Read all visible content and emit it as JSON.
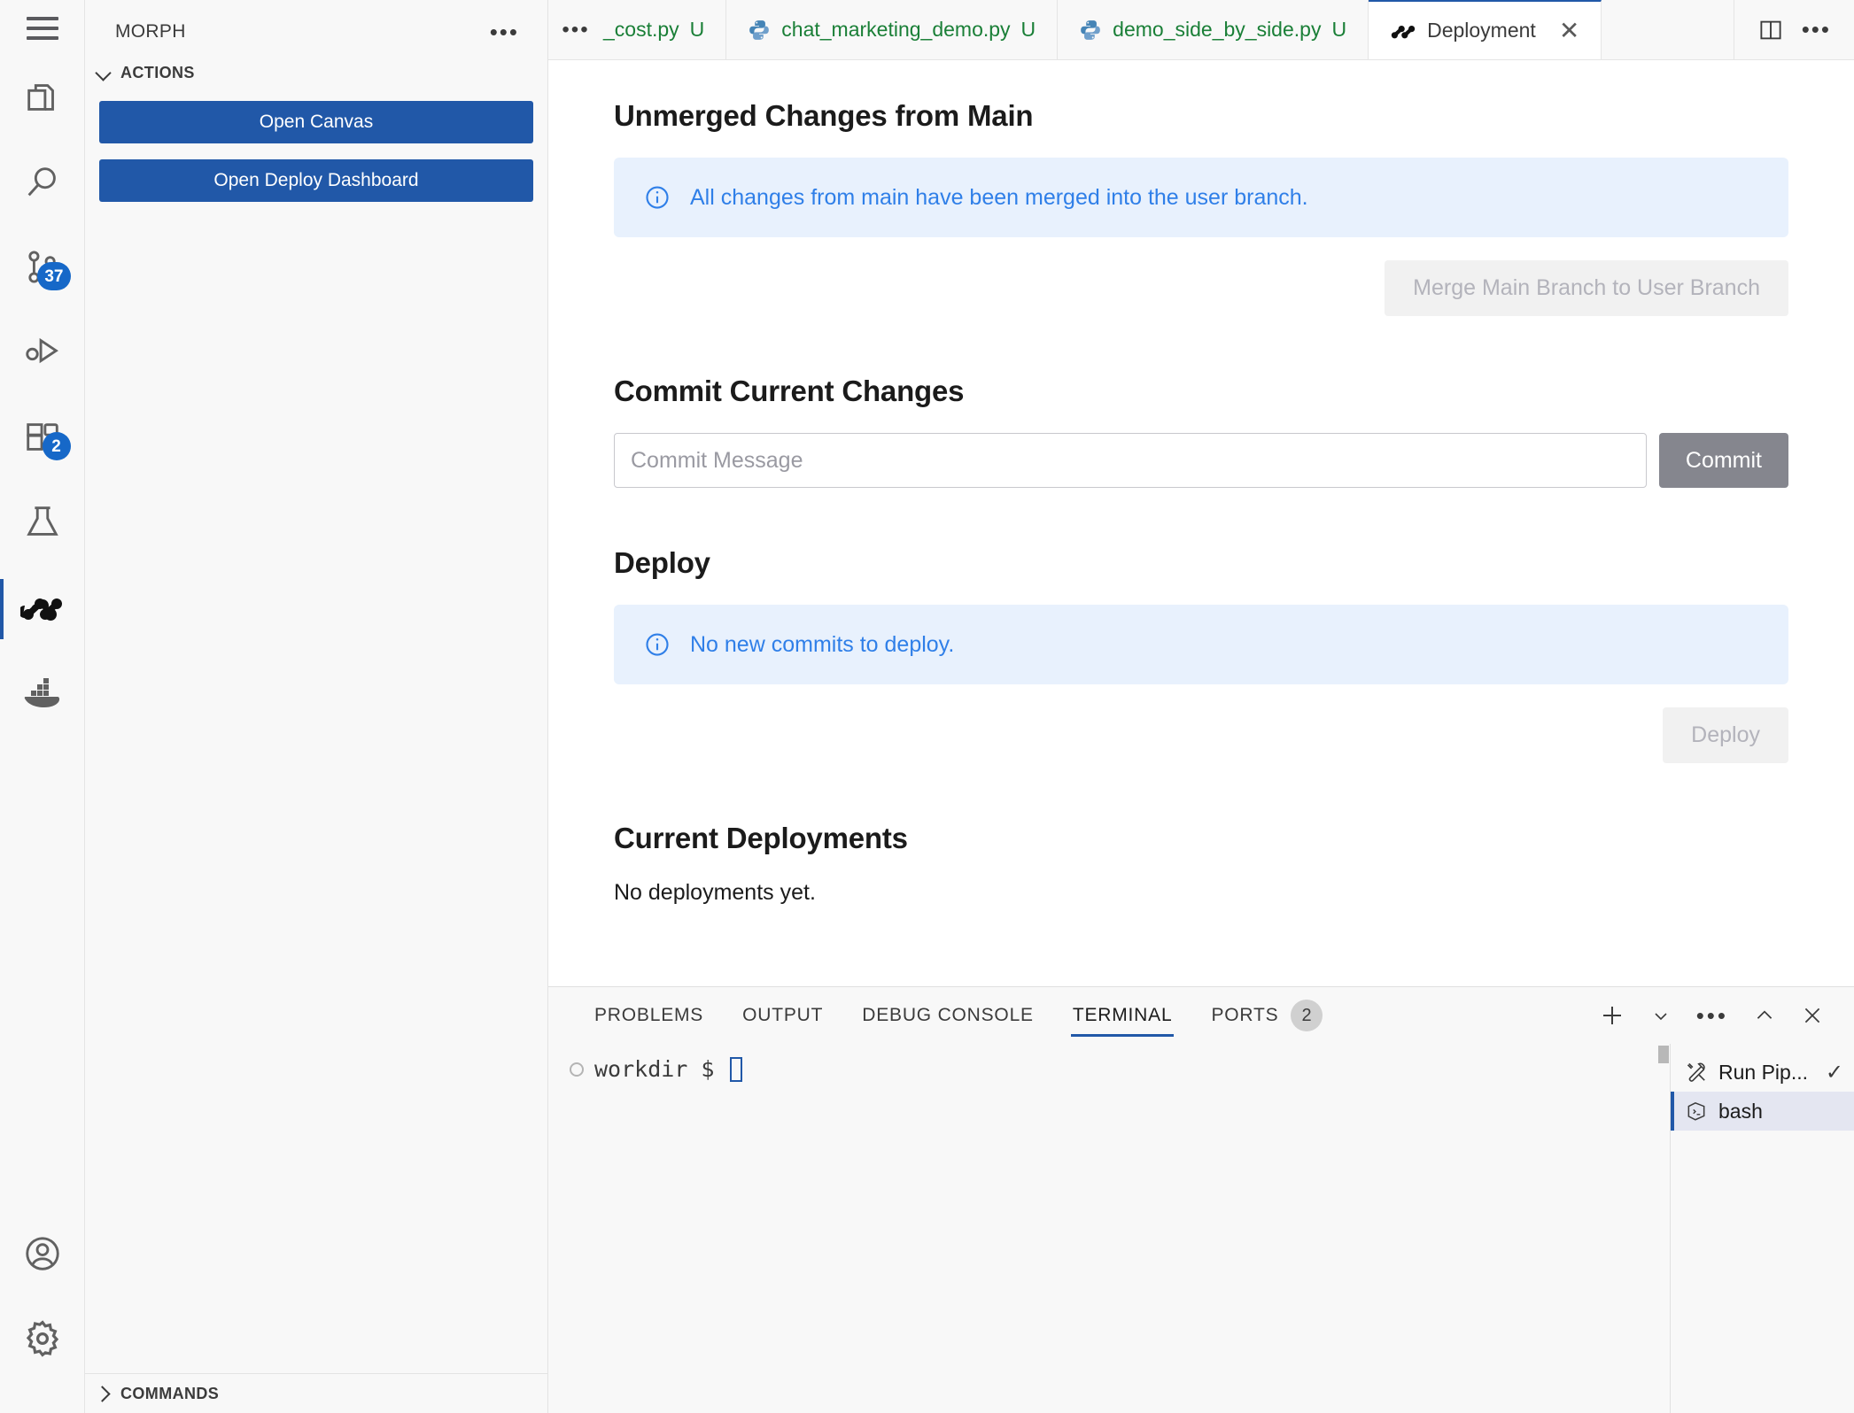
{
  "activity_bar": {
    "menu_icon": "hamburger-menu-icon",
    "items": [
      {
        "name": "explorer",
        "icon": "files-icon",
        "badge": null,
        "active": false
      },
      {
        "name": "search",
        "icon": "search-icon",
        "badge": null,
        "active": false
      },
      {
        "name": "source-control",
        "icon": "source-control-icon",
        "badge": "37",
        "active": false
      },
      {
        "name": "run-and-debug",
        "icon": "run-debug-icon",
        "badge": null,
        "active": false
      },
      {
        "name": "extensions",
        "icon": "extensions-icon",
        "badge": "2",
        "active": false
      },
      {
        "name": "testing",
        "icon": "beaker-icon",
        "badge": null,
        "active": false
      },
      {
        "name": "morph",
        "icon": "morph-icon",
        "badge": null,
        "active": true
      },
      {
        "name": "docker",
        "icon": "docker-whale-icon",
        "badge": null,
        "active": false
      }
    ],
    "bottom_items": [
      {
        "name": "accounts",
        "icon": "account-icon"
      },
      {
        "name": "settings",
        "icon": "gear-icon"
      }
    ]
  },
  "sidebar": {
    "title": "MORPH",
    "more_label": "•••",
    "sections": [
      {
        "label": "ACTIONS",
        "expanded": true
      },
      {
        "label": "COMMANDS",
        "expanded": false
      }
    ],
    "buttons": [
      {
        "label": "Open Canvas"
      },
      {
        "label": "Open Deploy Dashboard"
      }
    ]
  },
  "tabs": {
    "overflow_label": "•••",
    "items": [
      {
        "label": "_cost.py",
        "dirty": "U",
        "icon": "python-icon",
        "active": false,
        "truncated": true
      },
      {
        "label": "chat_marketing_demo.py",
        "dirty": "U",
        "icon": "python-icon",
        "active": false,
        "truncated": false
      },
      {
        "label": "demo_side_by_side.py",
        "dirty": "U",
        "icon": "python-icon",
        "active": false,
        "truncated": false
      },
      {
        "label": "Deployment",
        "dirty": "",
        "icon": "morph-icon",
        "active": true,
        "truncated": false
      }
    ],
    "actions": [
      {
        "name": "split-editor",
        "icon": "split-editor-icon"
      },
      {
        "name": "more-actions",
        "icon": "ellipsis-icon",
        "label": "•••"
      }
    ]
  },
  "main": {
    "unmerged": {
      "heading": "Unmerged Changes from Main",
      "info": "All changes from main have been merged into the user branch.",
      "button": "Merge Main Branch to User Branch"
    },
    "commit": {
      "heading": "Commit Current Changes",
      "placeholder": "Commit Message",
      "value": "",
      "button": "Commit"
    },
    "deploy": {
      "heading": "Deploy",
      "info": "No new commits to deploy.",
      "button": "Deploy"
    },
    "deployments": {
      "heading": "Current Deployments",
      "empty_text": "No deployments yet."
    }
  },
  "panel": {
    "tabs": [
      {
        "label": "PROBLEMS",
        "active": false,
        "badge": null
      },
      {
        "label": "OUTPUT",
        "active": false,
        "badge": null
      },
      {
        "label": "DEBUG CONSOLE",
        "active": false,
        "badge": null
      },
      {
        "label": "TERMINAL",
        "active": true,
        "badge": null
      },
      {
        "label": "PORTS",
        "active": false,
        "badge": "2"
      }
    ],
    "actions": [
      {
        "name": "new-terminal",
        "icon": "plus-icon"
      },
      {
        "name": "terminal-dropdown",
        "icon": "chevron-down-icon"
      },
      {
        "name": "panel-more",
        "icon": "ellipsis-icon",
        "label": "•••"
      },
      {
        "name": "maximize-panel",
        "icon": "chevron-up-icon"
      },
      {
        "name": "close-panel",
        "icon": "close-icon"
      }
    ],
    "terminal": {
      "prompt": "workdir $",
      "command": ""
    },
    "terminal_list": [
      {
        "label": "Run Pip...",
        "icon": "tools-icon",
        "selected": false,
        "status": "✓"
      },
      {
        "label": "bash",
        "icon": "terminal-icon",
        "selected": true,
        "status": ""
      }
    ]
  },
  "colors": {
    "accent_blue": "#2158a8",
    "info_bg": "#e8f1fd",
    "info_text": "#2f7fe8",
    "tab_green": "#1a7f37",
    "badge_blue": "#1668c8",
    "commit_btn": "#85868e"
  }
}
